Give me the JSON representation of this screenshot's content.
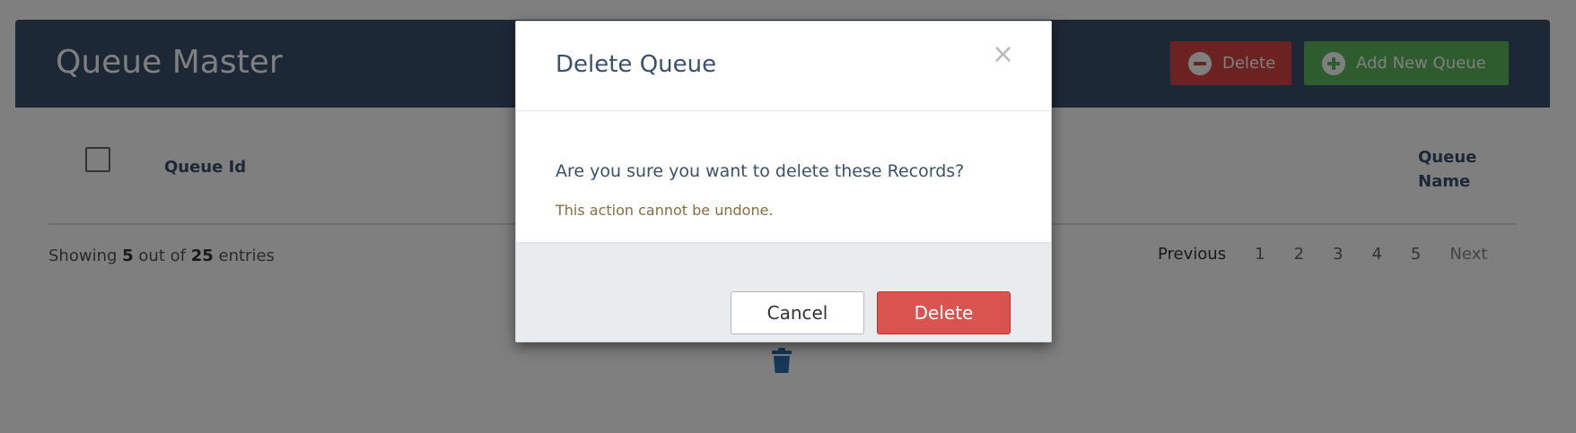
{
  "header": {
    "title": "Queue Master",
    "delete_label": "Delete",
    "add_label": "Add New Queue"
  },
  "table": {
    "columns": [
      "Queue Id",
      "Queue Name"
    ]
  },
  "footer": {
    "showing_prefix": "Showing",
    "shown_count": "5",
    "out_of": "out of",
    "total_count": "25",
    "entries": "entries"
  },
  "pagination": {
    "previous": "Previous",
    "pages": [
      "1",
      "2",
      "3",
      "4",
      "5"
    ],
    "next": "Next"
  },
  "modal": {
    "title": "Delete Queue",
    "close_glyph": "×",
    "question": "Are you sure you want to delete these Records?",
    "warning": "This action cannot be undone.",
    "cancel_label": "Cancel",
    "delete_label": "Delete"
  },
  "colors": {
    "header_bg": "#3b506e",
    "danger": "#d9534f",
    "success": "#5cb85c",
    "overlay": "rgba(0,0,0,0.5)"
  },
  "icons": {
    "header_delete": "minus-circle-icon",
    "header_add": "plus-circle-icon",
    "floating": "trash-icon"
  }
}
